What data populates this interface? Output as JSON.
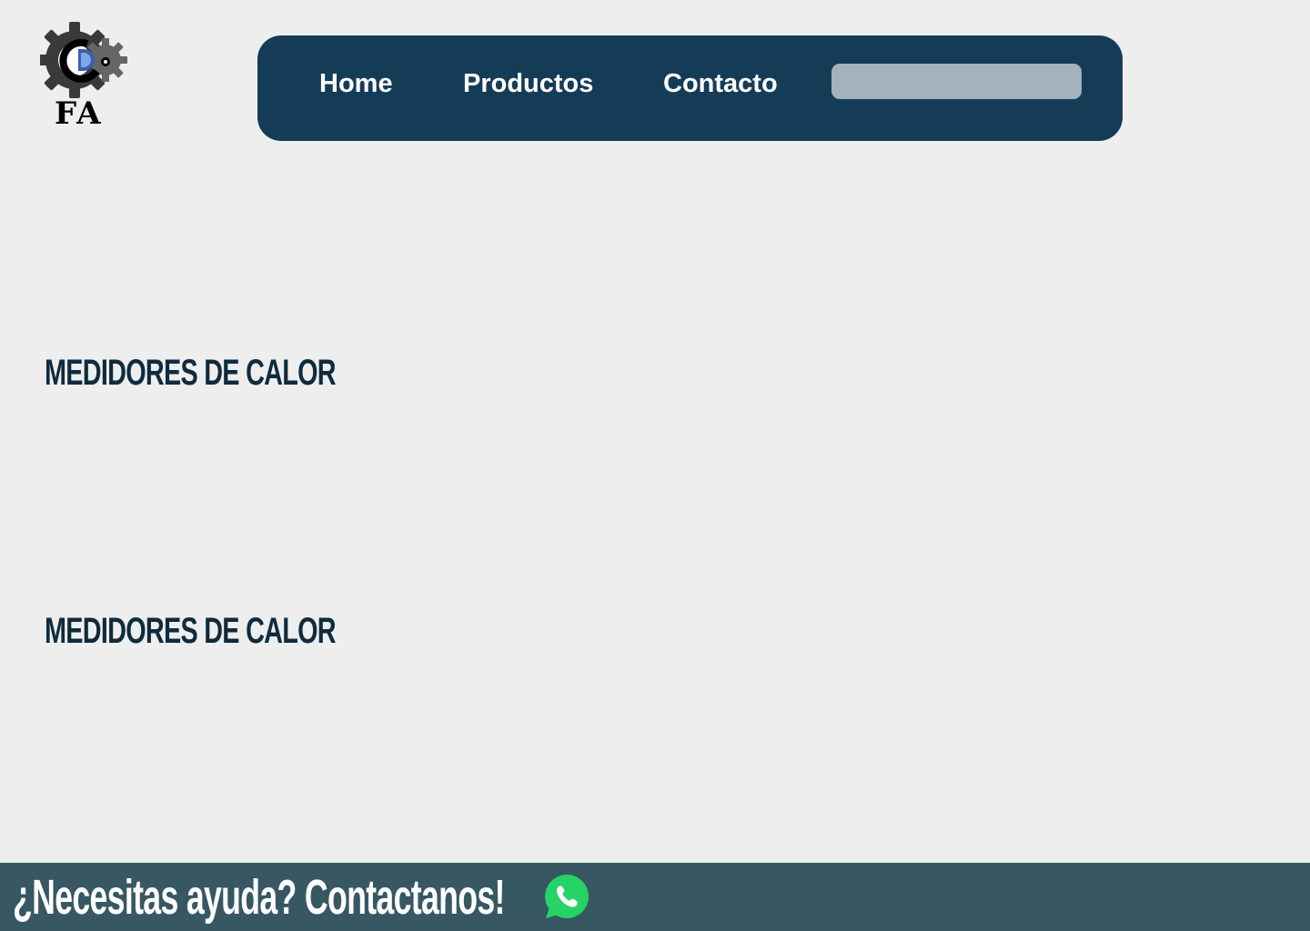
{
  "header": {
    "logo_text": "FA"
  },
  "nav": {
    "items": [
      {
        "label": "Home"
      },
      {
        "label": "Productos"
      },
      {
        "label": "Contacto"
      }
    ],
    "search": {
      "value": "",
      "placeholder": ""
    }
  },
  "sections": [
    {
      "title": "MEDIDORES DE CALOR"
    },
    {
      "title": "MEDIDORES DE CALOR"
    }
  ],
  "footer": {
    "cta_text": "¿Necesitas ayuda? Contactanos!",
    "icon": "whatsapp-icon"
  },
  "colors": {
    "background": "#eeeeee",
    "navbar": "#153c57",
    "search_field": "#a4b2bb",
    "heading": "#0f2b3d",
    "footer": "#375763",
    "whatsapp": "#25d366"
  }
}
